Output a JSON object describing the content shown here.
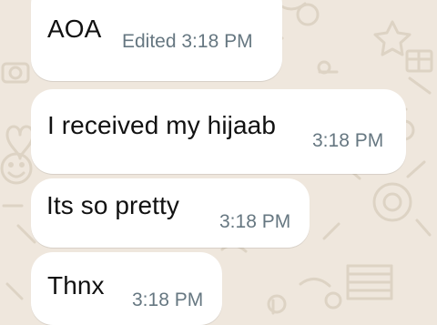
{
  "theme": {
    "background": "#efe7dd",
    "bubble": "#ffffff",
    "text": "#111111",
    "meta": "#667781"
  },
  "messages": [
    {
      "text": "AOA",
      "edited_label": "Edited",
      "time": "3:18 PM",
      "meta": "Edited 3:18 PM"
    },
    {
      "text": "I received my hijaab",
      "time": "3:18 PM",
      "meta": "3:18 PM"
    },
    {
      "text": "Its so pretty",
      "time": "3:18 PM",
      "meta": "3:18 PM"
    },
    {
      "text": "Thnx",
      "time": "3:18 PM",
      "meta": "3:18 PM"
    }
  ],
  "wallpaper_icons": [
    "heart-icon",
    "smiley-icon",
    "camera-icon",
    "star-icon",
    "gift-icon",
    "coin-stack-icon",
    "bicycle-icon"
  ]
}
